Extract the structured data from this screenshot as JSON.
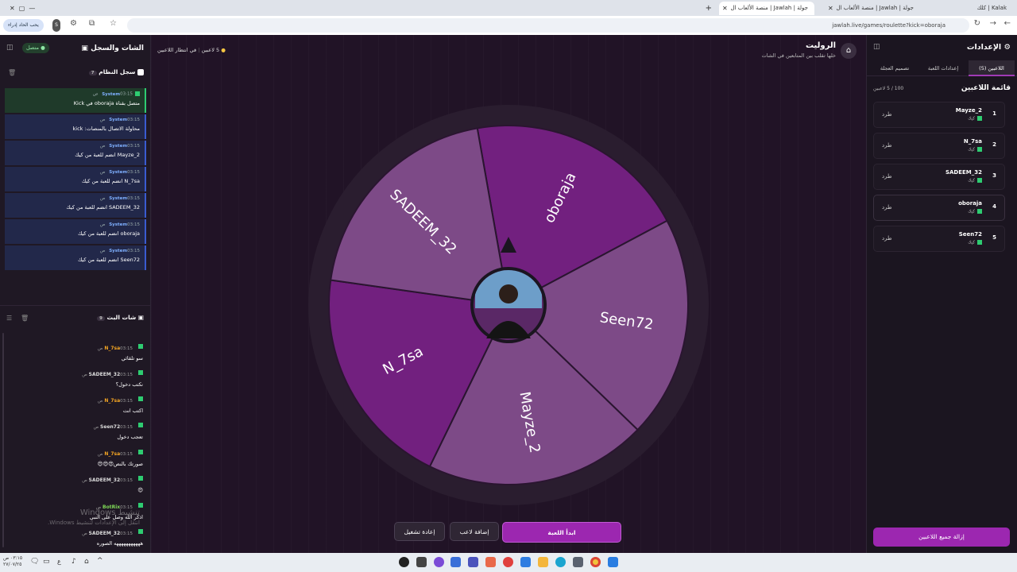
{
  "browser": {
    "tabs": [
      "Kalak | كلك",
      "جولة | Jawlah | منصة الألعاب ال",
      "جولة | Jawlah | منصة الألعاب ال"
    ],
    "url": "jawlah.live/games/roulette?kick=oboraja",
    "side_button": "يحب الحاد إدراء"
  },
  "settings": {
    "title": "الإعدادات",
    "tabs": [
      "اللاعبين (5)",
      "إعدادات اللعبة",
      "تصميم العجلة"
    ],
    "list_title": "قائمة اللاعبين",
    "count": "100 / 5 لاعبين",
    "players": [
      {
        "num": "1",
        "name": "Mayze_2",
        "platform": "كيك",
        "kick": "طرد"
      },
      {
        "num": "2",
        "name": "N_7sa",
        "platform": "كيك",
        "kick": "طرد"
      },
      {
        "num": "3",
        "name": "SADEEM_32",
        "platform": "كيك",
        "kick": "طرد"
      },
      {
        "num": "4",
        "name": "oboraja",
        "platform": "كيك",
        "kick": "طرد"
      },
      {
        "num": "5",
        "name": "Seen72",
        "platform": "كيك",
        "kick": "طرد"
      }
    ],
    "remove_all": "إزالة جميع اللاعبين"
  },
  "game": {
    "title": "الروليت",
    "subtitle": "خلها تقلب بين المتابعين في الشات",
    "players_count": "5 لاعبين",
    "waiting": "في انتظار اللاعبين",
    "start": "ابدأ اللعبة",
    "add_player": "إضافة لاعب",
    "restart": "إعادة تشغيل"
  },
  "wheel": {
    "segments": [
      {
        "name": "oboraja",
        "color": "#72207f"
      },
      {
        "name": "Seen72",
        "color": "#7d4a87"
      },
      {
        "name": "Mayze_2",
        "color": "#7d4a87"
      },
      {
        "name": "N_7sa",
        "color": "#72207f"
      },
      {
        "name": "SADEEM_32",
        "color": "#7d4a87"
      }
    ]
  },
  "chat": {
    "title": "الشات والسجل",
    "status": "متصل",
    "log_title": "سجل النظام",
    "log_count": "7",
    "log": [
      {
        "who": "System",
        "time": "03:15 ص",
        "text": "متصل بقناة oboraja في Kick"
      },
      {
        "who": "System",
        "time": "03:15 ص",
        "text": "محاولة الاتصال بالمنصات: kick"
      },
      {
        "who": "System",
        "time": "03:15 ص",
        "text": "Mayze_2 انضم للعبة من كيك"
      },
      {
        "who": "System",
        "time": "03:15 ص",
        "text": "N_7sa انضم للعبة من كيك"
      },
      {
        "who": "System",
        "time": "03:15 ص",
        "text": "SADEEM_32 انضم للعبة من كيك"
      },
      {
        "who": "System",
        "time": "03:15 ص",
        "text": "oboraja انضم للعبة من كيك"
      },
      {
        "who": "System",
        "time": "03:15 ص",
        "text": "Seen72 انضم للعبة من كيك"
      }
    ],
    "live_title": "شات البث",
    "live_count": "9",
    "messages": [
      {
        "name": "N_7sa",
        "time": "03:15 ص",
        "text": "سو تلقائي",
        "color": "#f5a623"
      },
      {
        "name": "SADEEM_32",
        "time": "03:15 ص",
        "text": "نكتب دخول؟",
        "color": "#dcdcdc"
      },
      {
        "name": "N_7sa",
        "time": "03:15 ص",
        "text": "اكتب انت",
        "color": "#f5a623"
      },
      {
        "name": "Seen72",
        "time": "03:15 ص",
        "text": "تعجب دخول",
        "color": "#dcdcdc"
      },
      {
        "name": "N_7sa",
        "time": "03:15 ص",
        "text": "صورتك بالنص😍😍😍",
        "color": "#f5a623"
      },
      {
        "name": "SADEEM_32",
        "time": "03:15 ص",
        "text": "😍",
        "color": "#dcdcdc"
      },
      {
        "name": "BotRix",
        "time": "03:15 ص",
        "text": "اذكر الله وصل على النبي",
        "color": "#7ed957"
      },
      {
        "name": "SADEEM_32",
        "time": "03:15 ص",
        "text": "هههههههههههه الصوره",
        "color": "#dcdcdc"
      }
    ]
  },
  "watermark": {
    "line1": "تنشيط Windows",
    "line2": "انتقل إلى الإعدادات لتنشيط Windows."
  },
  "taskbar": {
    "time": "٠٣:١٥ ص",
    "date": "٢٧/٠٧/٢٥"
  }
}
